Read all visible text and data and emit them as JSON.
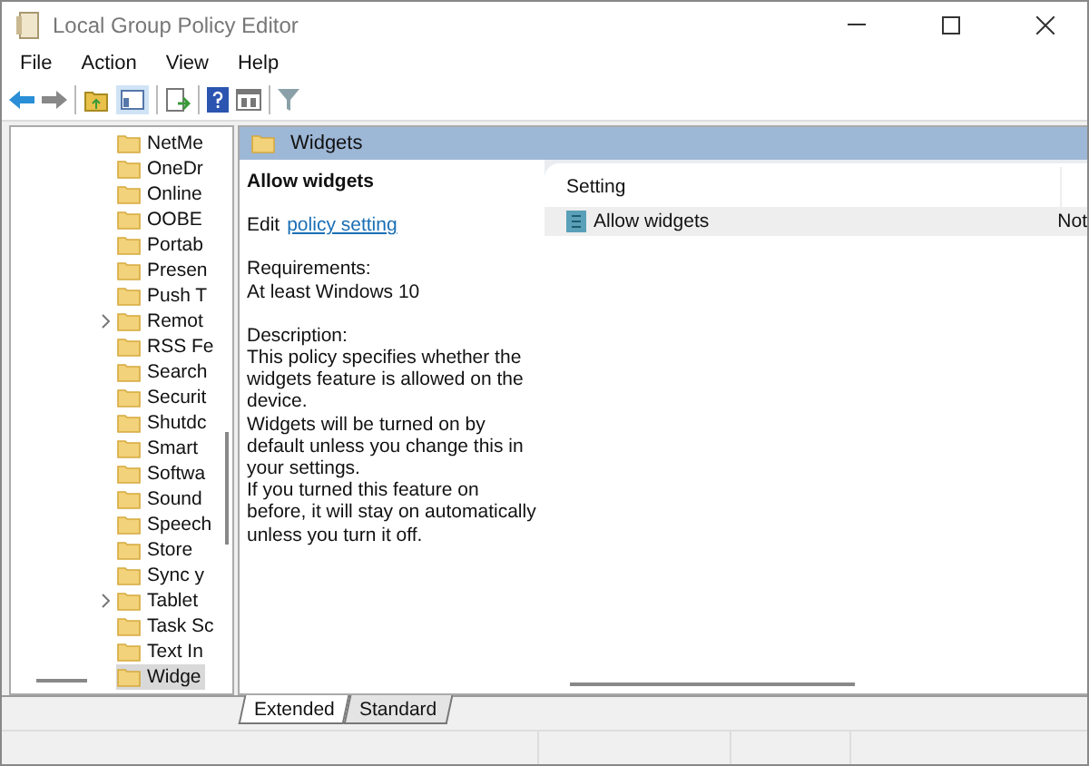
{
  "window": {
    "title": "Local Group Policy Editor"
  },
  "menu": [
    "File",
    "Action",
    "View",
    "Help"
  ],
  "tree": [
    {
      "label": "NetMe",
      "expandable": false,
      "selected": false
    },
    {
      "label": "OneDr",
      "expandable": false,
      "selected": false
    },
    {
      "label": "Online",
      "expandable": false,
      "selected": false
    },
    {
      "label": "OOBE",
      "expandable": false,
      "selected": false
    },
    {
      "label": "Portab",
      "expandable": false,
      "selected": false
    },
    {
      "label": "Presen",
      "expandable": false,
      "selected": false
    },
    {
      "label": "Push T",
      "expandable": false,
      "selected": false
    },
    {
      "label": "Remot",
      "expandable": true,
      "selected": false
    },
    {
      "label": "RSS Fe",
      "expandable": false,
      "selected": false
    },
    {
      "label": "Search",
      "expandable": false,
      "selected": false
    },
    {
      "label": "Securit",
      "expandable": false,
      "selected": false
    },
    {
      "label": "Shutdc",
      "expandable": false,
      "selected": false
    },
    {
      "label": "Smart",
      "expandable": false,
      "selected": false
    },
    {
      "label": "Softwa",
      "expandable": false,
      "selected": false
    },
    {
      "label": "Sound",
      "expandable": false,
      "selected": false
    },
    {
      "label": "Speech",
      "expandable": false,
      "selected": false
    },
    {
      "label": "Store",
      "expandable": false,
      "selected": false
    },
    {
      "label": "Sync y",
      "expandable": false,
      "selected": false
    },
    {
      "label": "Tablet",
      "expandable": true,
      "selected": false
    },
    {
      "label": "Task Sc",
      "expandable": false,
      "selected": false
    },
    {
      "label": "Text In",
      "expandable": false,
      "selected": false
    },
    {
      "label": "Widge",
      "expandable": false,
      "selected": true
    }
  ],
  "header": {
    "title": "Widgets"
  },
  "details": {
    "title": "Allow widgets",
    "edit_prefix": "Edit",
    "edit_link": "policy setting",
    "requirements_label": "Requirements:",
    "requirements": "At least Windows 10",
    "description_label": "Description:",
    "description": [
      "This policy specifies whether the widgets feature is allowed on the device.",
      "Widgets will be turned on by default unless you change this in your settings.",
      "If you turned this feature on before, it will stay on automatically unless you turn it off."
    ]
  },
  "list": {
    "columns": [
      "Setting"
    ],
    "rows": [
      {
        "setting": "Allow widgets",
        "state": "Not",
        "selected": true
      }
    ]
  },
  "tabs": [
    {
      "label": "Extended",
      "selected": true
    },
    {
      "label": "Standard",
      "selected": false
    }
  ]
}
